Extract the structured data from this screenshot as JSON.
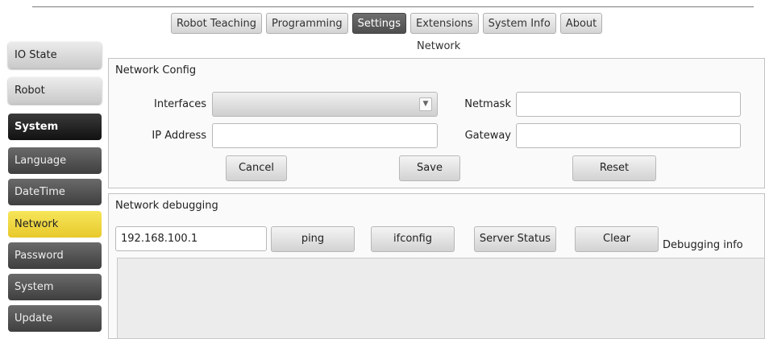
{
  "tabs": [
    {
      "label": "Robot Teaching"
    },
    {
      "label": "Programming"
    },
    {
      "label": "Settings"
    },
    {
      "label": "Extensions"
    },
    {
      "label": "System Info"
    },
    {
      "label": "About"
    }
  ],
  "section_title": "Network",
  "sidebar": {
    "items": [
      {
        "label": "IO State"
      },
      {
        "label": "Robot"
      },
      {
        "label": "System"
      },
      {
        "label": "Language"
      },
      {
        "label": "DateTime"
      },
      {
        "label": "Network"
      },
      {
        "label": "Password"
      },
      {
        "label": "System"
      },
      {
        "label": "Update"
      }
    ]
  },
  "network_config": {
    "title": "Network Config",
    "interfaces_label": "Interfaces",
    "interfaces_value": "",
    "netmask_label": "Netmask",
    "netmask_value": "",
    "ip_label": "IP Address",
    "ip_value": "",
    "gateway_label": "Gateway",
    "gateway_value": "",
    "cancel_label": "Cancel",
    "save_label": "Save",
    "reset_label": "Reset"
  },
  "network_debugging": {
    "title": "Network debugging",
    "address_value": "192.168.100.1",
    "ping_label": "ping",
    "ifconfig_label": "ifconfig",
    "server_status_label": "Server Status",
    "clear_label": "Clear",
    "debug_info_label": "Debugging info"
  }
}
